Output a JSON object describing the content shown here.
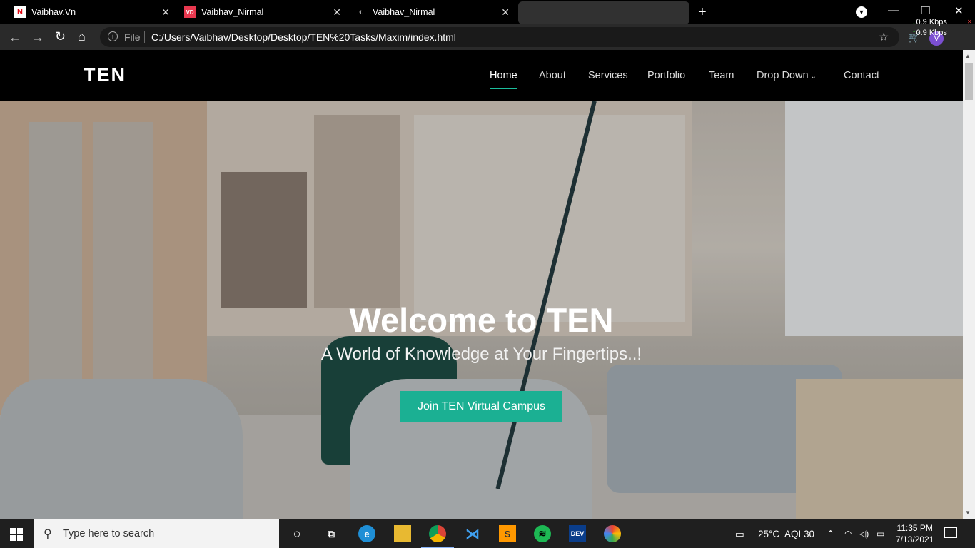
{
  "browser": {
    "tabs": [
      {
        "title": "Vaibhav.Vn",
        "favicon_letter": "N",
        "favicon_color": "#e50914",
        "active": false
      },
      {
        "title": "Vaibhav_Nirmal",
        "favicon_letter": "VD",
        "favicon_color": "#e8384f",
        "active": false
      },
      {
        "title": "Vaibhav_Nirmal",
        "favicon_letter": "◐",
        "favicon_color": "#888888",
        "active": false
      }
    ],
    "new_tab_icon": "plus-icon",
    "window_controls": {
      "minimize": "—",
      "maximize": "❐",
      "close": "✕"
    },
    "net_speed": {
      "down": "0.9 Kbps",
      "up": "0.9 Kbps"
    },
    "address_bar": {
      "scheme_label": "File",
      "url": "C:/Users/Vaibhav/Desktop/Desktop/TEN%20Tasks/Maxim/index.html"
    },
    "avatar_letter": "V"
  },
  "site": {
    "logo": "TEN",
    "nav": [
      {
        "label": "Home",
        "active": true
      },
      {
        "label": "About",
        "active": false
      },
      {
        "label": "Services",
        "active": false
      },
      {
        "label": "Portfolio",
        "active": false
      },
      {
        "label": "Team",
        "active": false
      },
      {
        "label": "Drop Down",
        "active": false,
        "has_dropdown": true
      },
      {
        "label": "Contact",
        "active": false
      }
    ],
    "hero": {
      "title": "Welcome to TEN",
      "subtitle": "A World of Knowledge at Your Fingertips..!",
      "cta_label": "Join TEN Virtual Campus"
    },
    "accent_color": "#1bb093"
  },
  "taskbar": {
    "search_placeholder": "Type here to search",
    "weather": "25°C",
    "aqi": "AQI 30",
    "time": "11:35 PM",
    "date": "7/13/2021",
    "apps": [
      "cortana-icon",
      "task-view-icon",
      "edge-icon",
      "file-explorer-icon",
      "chrome-icon",
      "vscode-icon",
      "sublime-icon",
      "spotify-icon",
      "dev-icon",
      "chromium-icon"
    ]
  }
}
